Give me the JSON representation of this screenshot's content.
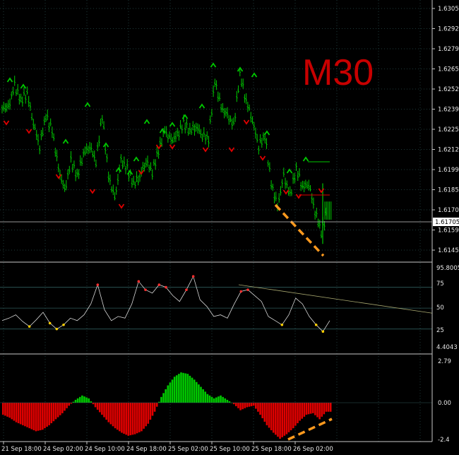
{
  "timeframe": "M30",
  "colors": {
    "background": "#000000",
    "grid": "#1e3a3a",
    "candle": "#00c800",
    "fractal_up": "#00c800",
    "fractal_down": "#e00000",
    "trend_line": "#ff9a1e",
    "rsi_line": "#d8d8d8",
    "macd_positive": "#00c800",
    "macd_negative": "#e00000",
    "label": "#e8e8e8",
    "timeframe_label": "#c80000"
  },
  "price_axis": {
    "labels": [
      "1.63055",
      "1.62925",
      "1.62790",
      "1.62655",
      "1.62525",
      "1.62390",
      "1.62255",
      "1.62125",
      "1.61990",
      "1.61855",
      "1.61705",
      "1.61590",
      "1.61455"
    ],
    "current_price": "1.61705"
  },
  "rsi_axis": {
    "labels": [
      "95.8005",
      "75",
      "50",
      "25",
      "4.4043"
    ]
  },
  "macd_axis": {
    "labels": [
      "2.79",
      "0.00",
      "-2.4"
    ]
  },
  "time_axis": {
    "labels": [
      "21 Sep 18:00",
      "24 Sep 02:00",
      "24 Sep 10:00",
      "24 Sep 18:00",
      "25 Sep 02:00",
      "25 Sep 10:00",
      "25 Sep 18:00",
      "26 Sep 02:00"
    ]
  },
  "chart_data": {
    "type": "line",
    "title": "M30",
    "price_series_close": [
      1.624,
      1.6255,
      1.6245,
      1.625,
      1.623,
      1.6215,
      1.6235,
      1.6225,
      1.62,
      1.6185,
      1.6205,
      1.6195,
      1.621,
      1.6215,
      1.6205,
      1.6235,
      1.6195,
      1.618,
      1.6205,
      1.62,
      1.619,
      1.6195,
      1.6205,
      1.6198,
      1.6212,
      1.6225,
      1.6218,
      1.6222,
      1.623,
      1.6225,
      1.6228,
      1.6222,
      1.622,
      1.6258,
      1.624,
      1.6235,
      1.6228,
      1.6262,
      1.6245,
      1.6232,
      1.6215,
      1.6222,
      1.619,
      1.6175,
      1.6195,
      1.6182,
      1.62,
      1.6188,
      1.619,
      1.6172,
      1.6158,
      1.6172
    ],
    "rsi_values": [
      35,
      38,
      42,
      34,
      28,
      36,
      45,
      32,
      25,
      30,
      38,
      35,
      42,
      55,
      78,
      48,
      35,
      40,
      38,
      55,
      82,
      72,
      68,
      78,
      75,
      65,
      58,
      72,
      88,
      60,
      52,
      40,
      42,
      38,
      55,
      70,
      72,
      65,
      58,
      40,
      35,
      30,
      42,
      62,
      55,
      40,
      30,
      22,
      35
    ],
    "macd_values": [
      -0.8,
      -1.0,
      -1.3,
      -1.5,
      -1.7,
      -1.9,
      -1.8,
      -1.5,
      -1.1,
      -0.7,
      -0.2,
      0.2,
      0.5,
      0.3,
      -0.3,
      -0.8,
      -1.3,
      -1.7,
      -2.0,
      -2.2,
      -2.1,
      -1.9,
      -1.4,
      -0.6,
      0.4,
      1.2,
      1.8,
      2.1,
      2.0,
      1.6,
      1.1,
      0.6,
      0.3,
      0.5,
      0.2,
      -0.1,
      -0.5,
      -0.3,
      -0.2,
      -0.8,
      -1.5,
      -2.0,
      -2.4,
      -2.1,
      -1.7,
      -1.2,
      -0.8,
      -0.7,
      -1.1,
      -0.6
    ],
    "rsi_levels": [
      75,
      50,
      25
    ],
    "rsi_range": [
      4.4043,
      95.8005
    ],
    "macd_range": [
      -2.4,
      2.79
    ],
    "price_range": [
      1.6145,
      1.63055
    ]
  }
}
